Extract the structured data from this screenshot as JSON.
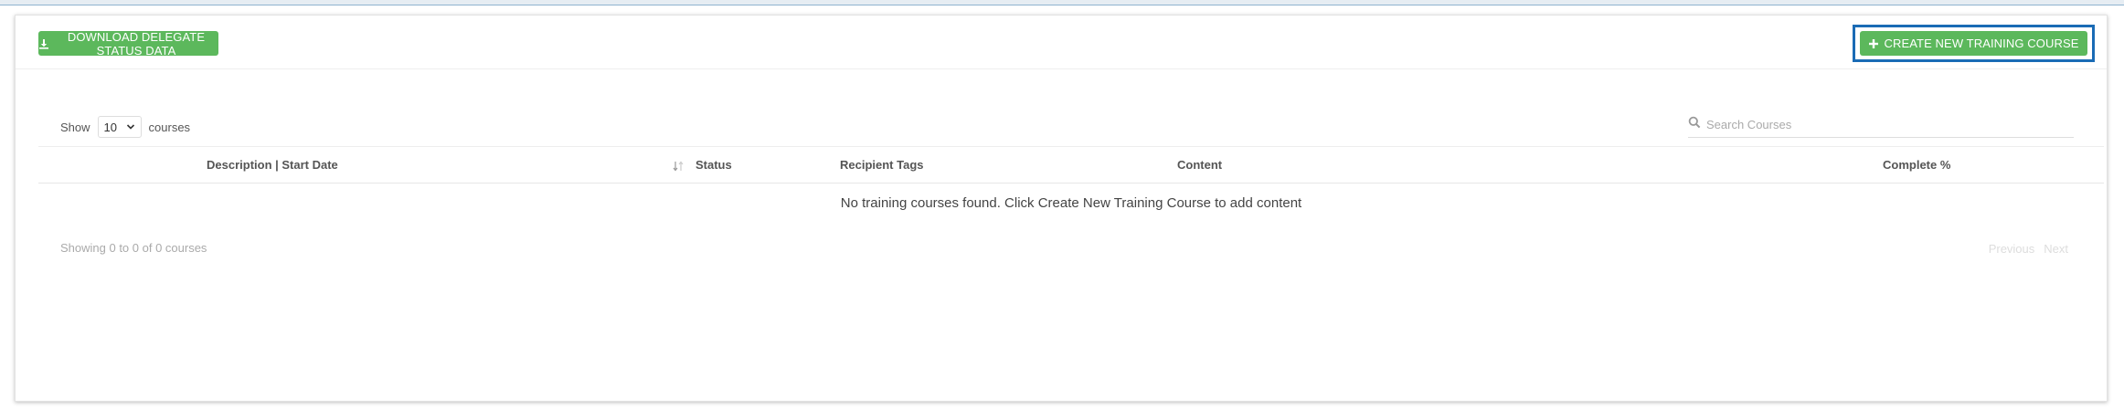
{
  "header": {
    "download_label": "DOWNLOAD DELEGATE STATUS DATA",
    "create_label": "CREATE NEW TRAINING COURSE"
  },
  "controls": {
    "show_label": "Show",
    "page_size": "10",
    "courses_label": "courses",
    "search_placeholder": "Search Courses"
  },
  "table": {
    "columns": [
      {
        "label": "Description | Start Date"
      },
      {
        "label": "Status"
      },
      {
        "label": "Recipient Tags"
      },
      {
        "label": "Content"
      },
      {
        "label": "Complete %"
      }
    ],
    "empty_message": "No training courses found. Click Create New Training Course to add content"
  },
  "footer": {
    "info": "Showing 0 to 0 of 0 courses",
    "previous": "Previous",
    "next": "Next"
  },
  "colors": {
    "button_green": "#5cb85c",
    "focus_blue": "#1a6bb5"
  },
  "icons": {
    "download": "download-icon",
    "create": "plus-icon",
    "search": "search-icon",
    "sort": "sort-icon",
    "select": "chevron-down-icon"
  }
}
